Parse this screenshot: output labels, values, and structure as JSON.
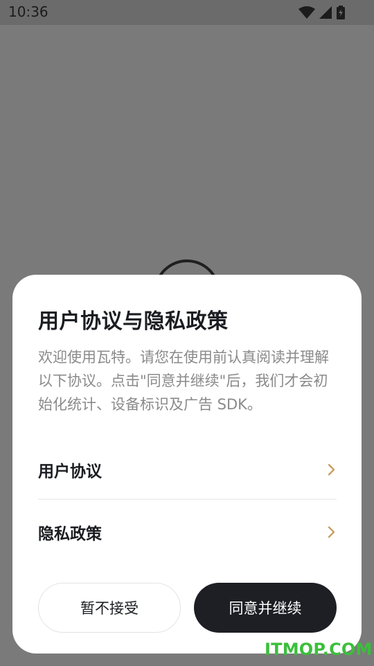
{
  "status_bar": {
    "time": "10:36",
    "icons": [
      "wifi-icon",
      "signal-icon",
      "battery-icon"
    ]
  },
  "dialog": {
    "title": "用户协议与隐私政策",
    "body": "欢迎使用瓦特。请您在使用前认真阅读并理解以下协议。点击\"同意并继续\"后，我们才会初始化统计、设备标识及广告 SDK。",
    "links": [
      {
        "label": "用户协议"
      },
      {
        "label": "隐私政策"
      }
    ],
    "decline_label": "暂不接受",
    "accept_label": "同意并继续"
  },
  "watermark": "ITMOP.COM",
  "colors": {
    "chevron": "#c8a064",
    "primary_button": "#1d1f24",
    "watermark": "#3bbf3b"
  }
}
